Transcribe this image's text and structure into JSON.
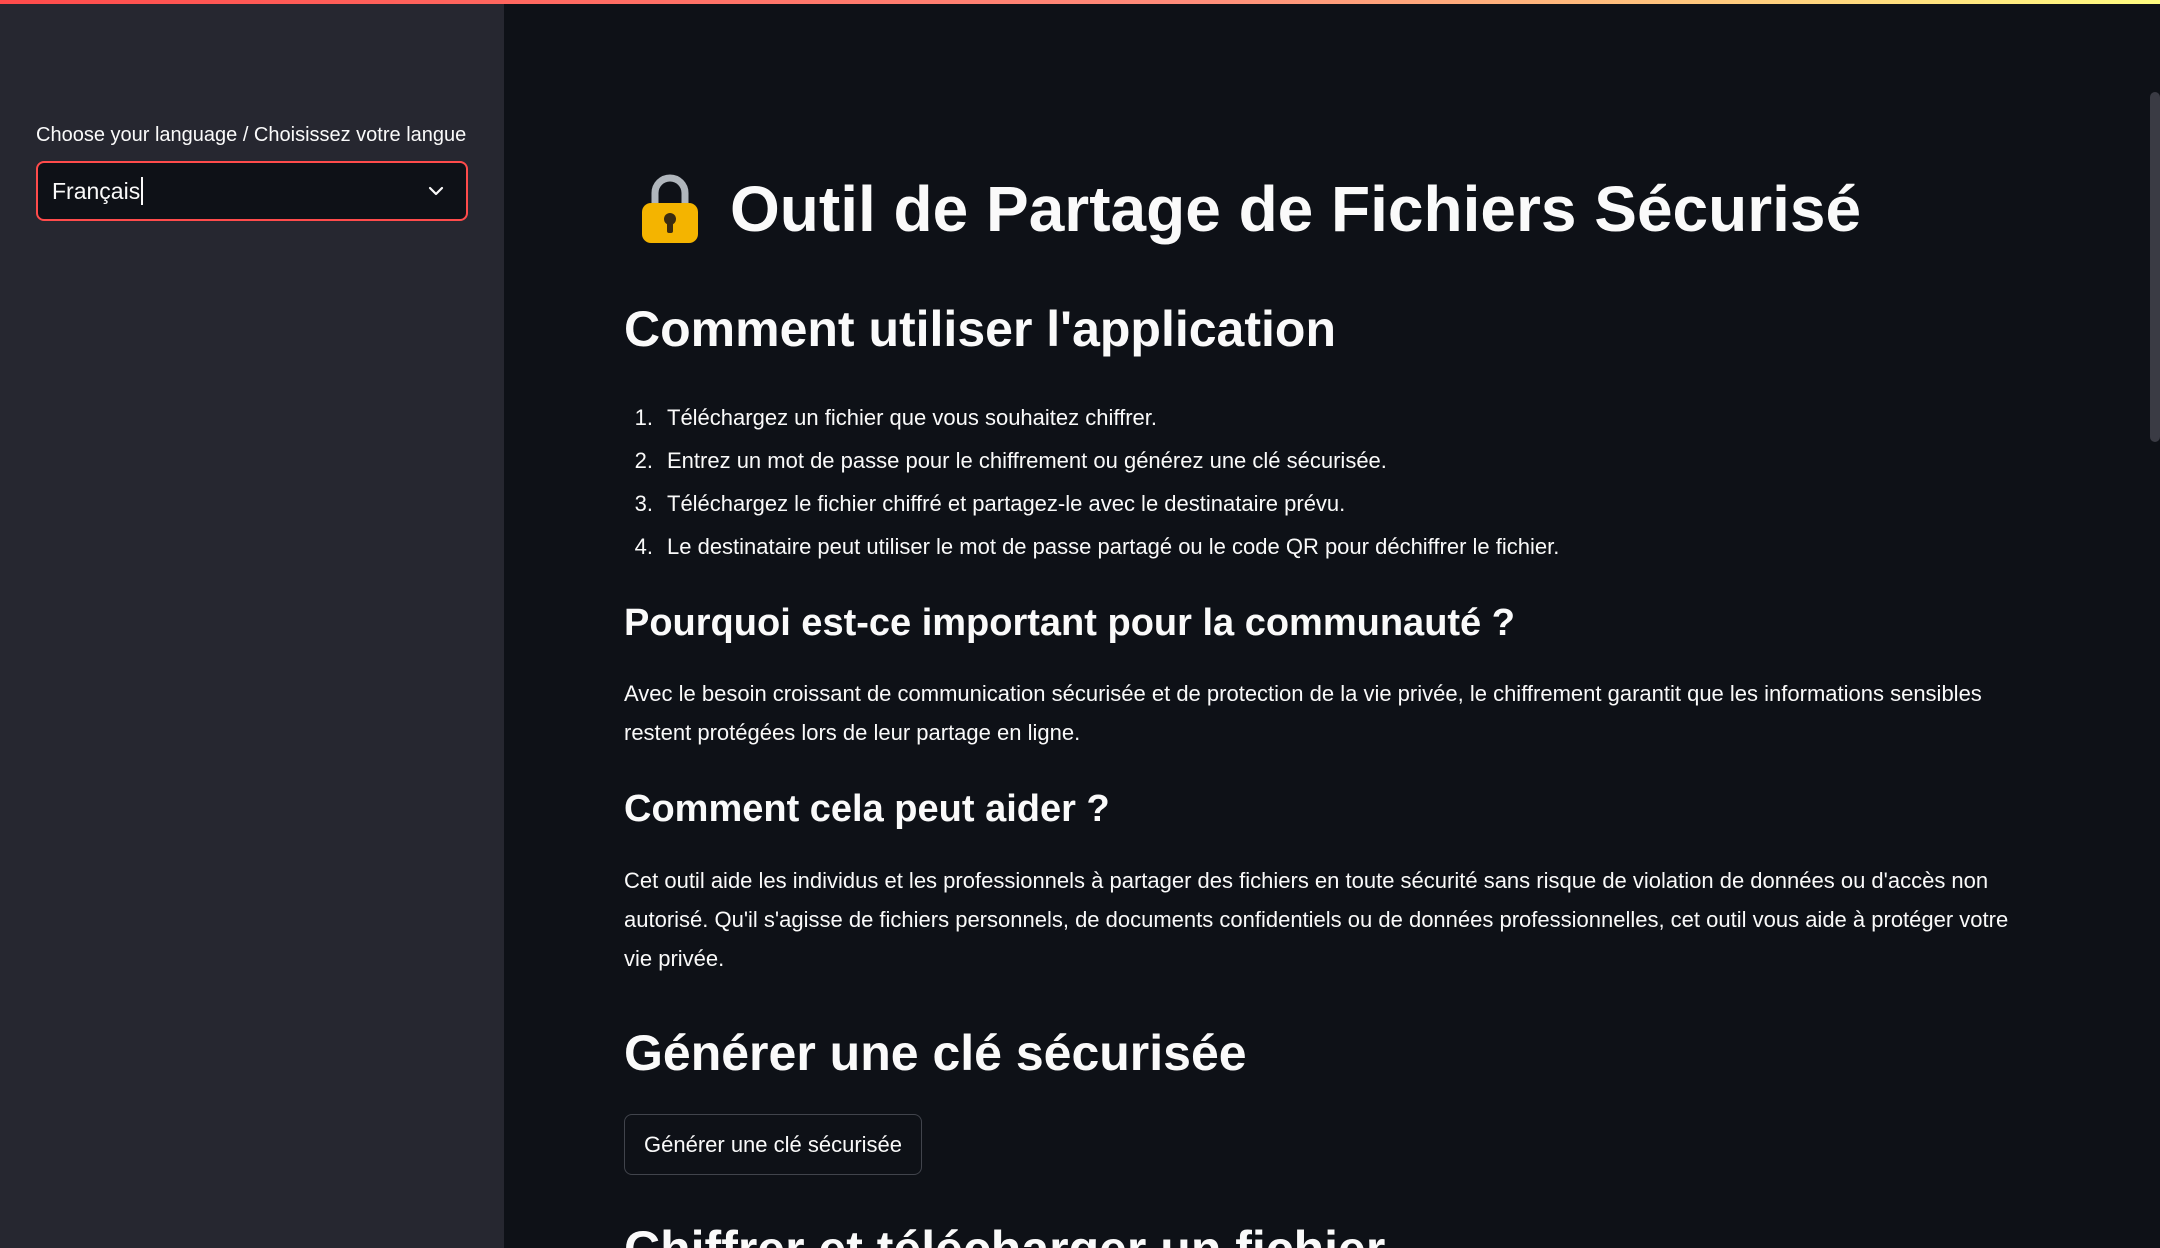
{
  "sidebar": {
    "language_label": "Choose your language / Choisissez votre langue",
    "language_value": "Français"
  },
  "main": {
    "title": "Outil de Partage de Fichiers Sécurisé",
    "how_to_heading": "Comment utiliser l'application",
    "steps": [
      {
        "num": "1.",
        "text": "Téléchargez un fichier que vous souhaitez chiffrer."
      },
      {
        "num": "2.",
        "text": "Entrez un mot de passe pour le chiffrement ou générez une clé sécurisée."
      },
      {
        "num": "3.",
        "text": "Téléchargez le fichier chiffré et partagez-le avec le destinataire prévu."
      },
      {
        "num": "4.",
        "text": "Le destinataire peut utiliser le mot de passe partagé ou le code QR pour déchiffrer le fichier."
      }
    ],
    "why_heading": "Pourquoi est-ce important pour la communauté ?",
    "why_text": "Avec le besoin croissant de communication sécurisée et de protection de la vie privée, le chiffrement garantit que les informations sensibles restent protégées lors de leur partage en ligne.",
    "help_heading": "Comment cela peut aider ?",
    "help_text": "Cet outil aide les individus et les professionnels à partager des fichiers en toute sécurité sans risque de violation de données ou d'accès non autorisé. Qu'il s'agisse de fichiers personnels, de documents confidentiels ou de données professionnelles, cet outil vous aide à protéger votre vie privée.",
    "generate_heading": "Générer une clé sécurisée",
    "generate_button": "Générer une clé sécurisée",
    "encrypt_heading": "Chiffrer et télécharger un fichier"
  },
  "colors": {
    "accent": "#ff4b4b",
    "sidebar_bg": "#262730",
    "main_bg": "#0e1117"
  },
  "icons": {
    "title_icon": "lock-icon",
    "select_icon": "chevron-down-icon"
  }
}
